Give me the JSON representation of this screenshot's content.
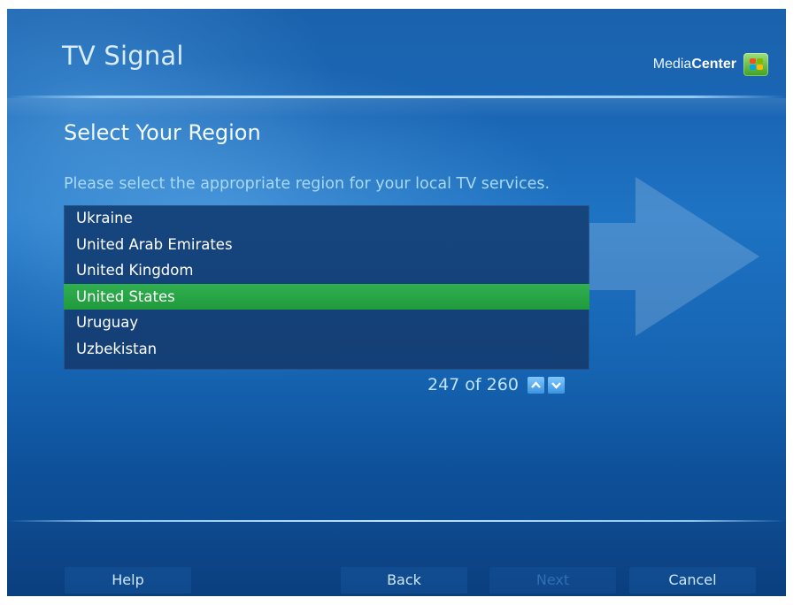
{
  "header": {
    "title": "TV Signal",
    "brand_light": "Media",
    "brand_bold": "Center"
  },
  "main": {
    "section_title": "Select Your Region",
    "instructions": "Please select the appropriate region for your local TV services.",
    "regions": [
      "Ukraine",
      "United Arab Emirates",
      "United Kingdom",
      "United States",
      "Uruguay",
      "Uzbekistan"
    ],
    "selected_region": "United States",
    "pager": {
      "text": "247 of 260"
    }
  },
  "footer": {
    "help": "Help",
    "back": "Back",
    "next": "Next",
    "cancel": "Cancel"
  },
  "colors": {
    "background": "#1a66b5",
    "selection": "#2aa84a",
    "list_background": "#15437b"
  },
  "icons": [
    "windows-flag-icon",
    "page-up-icon",
    "page-down-icon",
    "arrow-decoration-icon"
  ]
}
